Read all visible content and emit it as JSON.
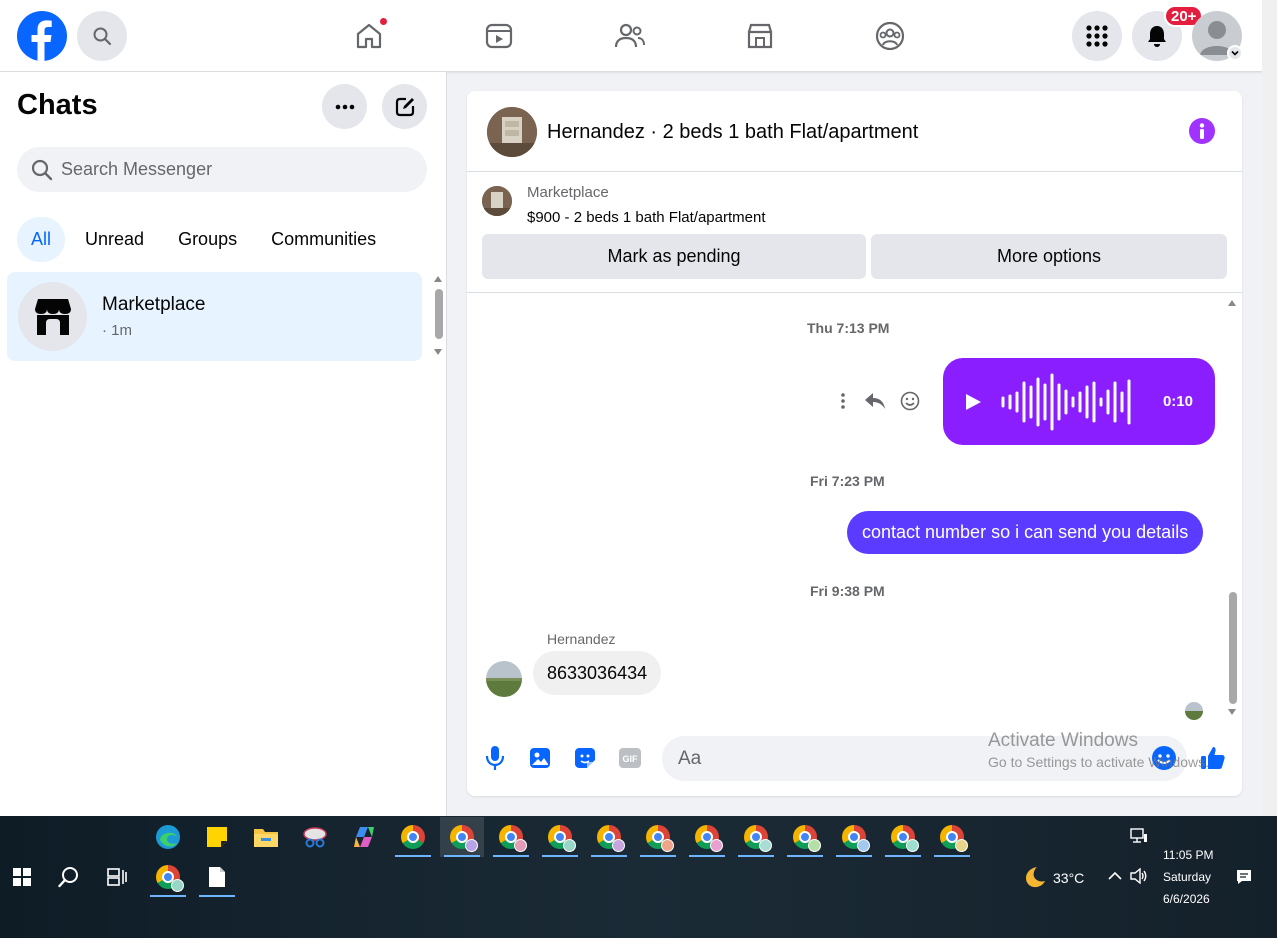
{
  "topbar": {
    "notifications_badge": "20+",
    "icons": [
      "facebook-logo",
      "search-icon",
      "home-icon",
      "video-icon",
      "friends-icon",
      "marketplace-icon",
      "groups-icon",
      "menu-grid-icon",
      "bell-icon",
      "profile-avatar"
    ]
  },
  "sidebar": {
    "title": "Chats",
    "search_placeholder": "Search Messenger",
    "tabs": [
      {
        "label": "All",
        "active": true
      },
      {
        "label": "Unread",
        "active": false
      },
      {
        "label": "Groups",
        "active": false
      },
      {
        "label": "Communities",
        "active": false
      }
    ],
    "chats": [
      {
        "name": "Marketplace",
        "meta": "· 1m",
        "selected": true
      }
    ]
  },
  "conversation": {
    "title": "Hernandez · 2 beds 1 bath Flat/apartment",
    "marketplace": {
      "label": "Marketplace",
      "listing": "$900 - 2 beds 1 bath Flat/apartment",
      "primary_button": "Mark as pending",
      "secondary_button": "More options"
    },
    "messages": [
      {
        "type": "timestamp",
        "text": "Thu 7:13 PM"
      },
      {
        "type": "audio",
        "direction": "out",
        "duration": "0:10"
      },
      {
        "type": "timestamp",
        "text": "Fri 7:23 PM"
      },
      {
        "type": "text",
        "direction": "out",
        "text": "contact number so i can send you details"
      },
      {
        "type": "timestamp",
        "text": "Fri 9:38 PM"
      },
      {
        "type": "text",
        "direction": "in",
        "sender": "Hernandez",
        "text": "8633036434"
      }
    ],
    "composer_placeholder": "Aa"
  },
  "watermark": {
    "title": "Activate Windows",
    "subtitle": "Go to Settings to activate Windows."
  },
  "taskbar": {
    "weather": "33°C",
    "time": "11:05 PM",
    "day": "Saturday",
    "date": "6/6/2026"
  },
  "colors": {
    "brand_blue": "#0866ff",
    "audio_bubble": "#8a1eff",
    "outgoing_bubble": "#5b3bff",
    "info_purple": "#a033ff",
    "badge_red": "#e41e3f"
  }
}
